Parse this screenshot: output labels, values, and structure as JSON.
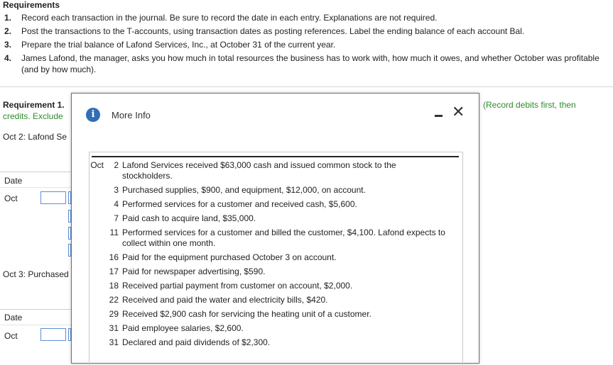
{
  "requirements": {
    "title": "Requirements",
    "items": [
      {
        "num": "1.",
        "text": "Record each transaction in the journal. Be sure to record the date in each entry. Explanations are not required."
      },
      {
        "num": "2.",
        "text": "Post the transactions to the T-accounts, using transaction dates as posting references. Label the ending balance of each account Bal."
      },
      {
        "num": "3.",
        "text": "Prepare the trial balance of Lafond Services, Inc., at October 31 of the current year."
      },
      {
        "num": "4.",
        "text": "James Lafond, the manager, asks you how much in total resources the business has to work with, how much it owes, and whether October was profitable (and by how much)."
      }
    ]
  },
  "background": {
    "req1_label": "Requirement 1.",
    "credits_text": "credits. Exclude",
    "record_hint": "(Record debits first, then",
    "oct2_label": "Oct 2: Lafond Se",
    "date_header_1": "Date",
    "oct_cell_1": "Oct",
    "oct3_label": "Oct 3: Purchased",
    "date_header_2": "Date",
    "oct_cell_2": "Oct"
  },
  "modal": {
    "title": "More Info",
    "transactions": [
      {
        "month": "Oct",
        "day": "2",
        "text": "Lafond Services received $63,000 cash and issued common stock to the stockholders."
      },
      {
        "month": "",
        "day": "3",
        "text": "Purchased supplies, $900, and equipment, $12,000, on account."
      },
      {
        "month": "",
        "day": "4",
        "text": "Performed services for a customer and received cash, $5,600."
      },
      {
        "month": "",
        "day": "7",
        "text": "Paid cash to acquire land, $35,000."
      },
      {
        "month": "",
        "day": "11",
        "text": "Performed services for a customer and billed the customer, $4,100. Lafond expects to collect within one month."
      },
      {
        "month": "",
        "day": "16",
        "text": "Paid for the equipment purchased October 3 on account."
      },
      {
        "month": "",
        "day": "17",
        "text": "Paid for newspaper advertising, $590."
      },
      {
        "month": "",
        "day": "18",
        "text": "Received partial payment from customer on account, $2,000."
      },
      {
        "month": "",
        "day": "22",
        "text": "Received and paid the water and electricity bills, $420."
      },
      {
        "month": "",
        "day": "29",
        "text": "Received $2,900 cash for servicing the heating unit of a customer."
      },
      {
        "month": "",
        "day": "31",
        "text": "Paid employee salaries, $2,600."
      },
      {
        "month": "",
        "day": "31",
        "text": "Declared and paid dividends of $2,300."
      }
    ]
  }
}
